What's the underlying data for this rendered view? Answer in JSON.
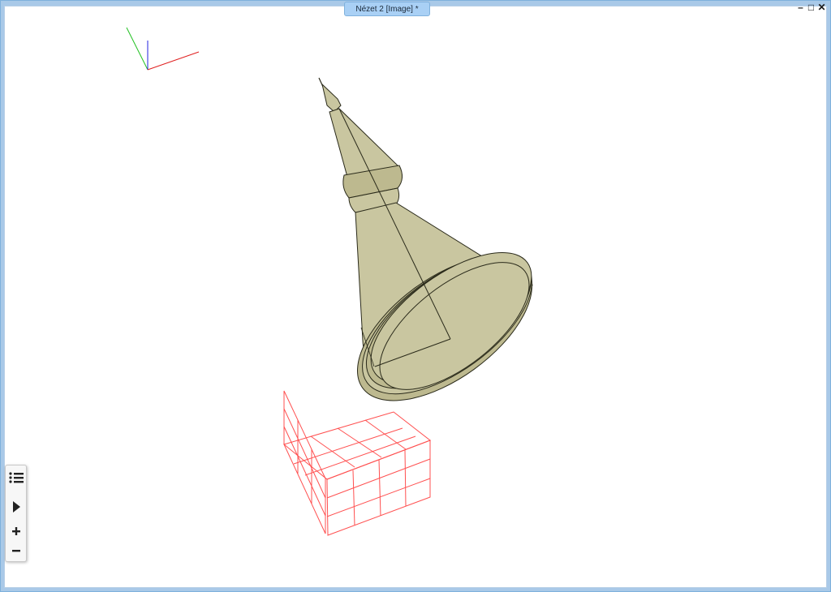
{
  "window": {
    "title": "Nézet 2 [Image] *",
    "controls": {
      "minimize": "–",
      "maximize": "□",
      "close": "✕"
    }
  },
  "view_toolbar": [
    {
      "name": "list-menu-icon"
    },
    {
      "name": "play-icon"
    },
    {
      "name": "zoom-in-icon"
    },
    {
      "name": "zoom-out-icon"
    }
  ],
  "colors": {
    "frame": "#a9c9e8",
    "model_fill": "#c9c6a0",
    "model_shadow": "#a9a67c",
    "grid_red": "#ff5050",
    "axis_x": "#e02020",
    "axis_y": "#20c020",
    "axis_z": "#2020e0"
  }
}
